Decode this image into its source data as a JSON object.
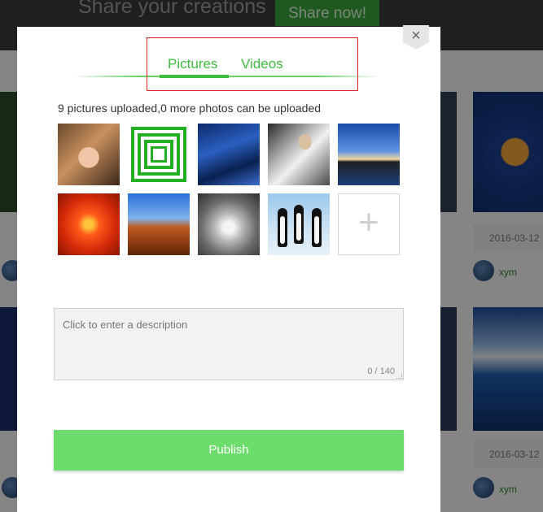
{
  "background": {
    "banner_title": "Share your creations",
    "banner_button": "Share now!",
    "cards": [
      {
        "date": "2016-03-12",
        "user": "xym"
      },
      {
        "date": "2016-03-12",
        "user": "xym"
      }
    ]
  },
  "modal": {
    "close_symbol": "×",
    "tabs": [
      {
        "label": "Pictures",
        "active": true
      },
      {
        "label": "Videos",
        "active": false
      }
    ],
    "upload_status": "9 pictures uploaded,0 more photos can be uploaded",
    "thumbnails": [
      {
        "icon": "girl-glasses-photo"
      },
      {
        "icon": "green-squares-photo"
      },
      {
        "icon": "blue-water-photo"
      },
      {
        "icon": "fashion-photo"
      },
      {
        "icon": "sunset-lake-photo"
      },
      {
        "icon": "red-flower-photo"
      },
      {
        "icon": "desert-rock-photo"
      },
      {
        "icon": "koala-photo"
      },
      {
        "icon": "penguins-photo"
      }
    ],
    "add_symbol": "+",
    "description": {
      "placeholder": "Click to enter a description",
      "value": "",
      "char_count": "0 / 140"
    },
    "publish_label": "Publish"
  },
  "colors": {
    "accent": "#3dbb3d",
    "publish_button": "#6cdc6c",
    "highlight_box": "#e02020"
  }
}
